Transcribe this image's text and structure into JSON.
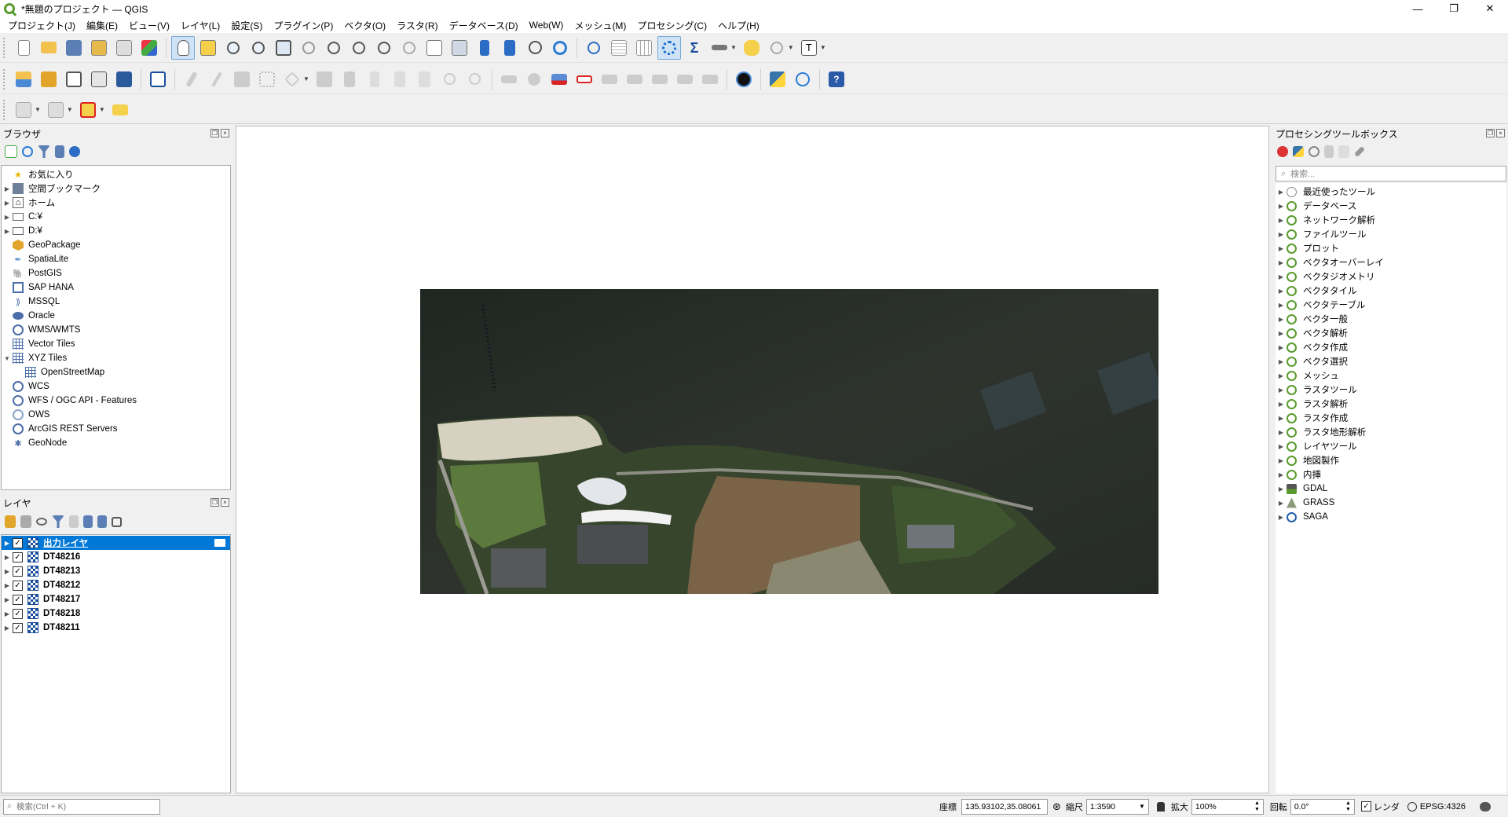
{
  "window": {
    "title": "*無題のプロジェクト — QGIS",
    "minimize": "—",
    "restore": "❐",
    "close": "✕"
  },
  "menu": [
    "プロジェクト(J)",
    "編集(E)",
    "ビュー(V)",
    "レイヤ(L)",
    "設定(S)",
    "プラグイン(P)",
    "ベクタ(O)",
    "ラスタ(R)",
    "データベース(D)",
    "Web(W)",
    "メッシュ(M)",
    "プロセシング(C)",
    "ヘルプ(H)"
  ],
  "browser": {
    "title": "ブラウザ",
    "items": [
      {
        "label": "お気に入り",
        "icon": "star-icon",
        "arrow": "",
        "indent": 0
      },
      {
        "label": "空間ブックマーク",
        "icon": "bookmark-icon",
        "arrow": "▶",
        "indent": 0
      },
      {
        "label": "ホーム",
        "icon": "home-folder-icon",
        "arrow": "▶",
        "indent": 0
      },
      {
        "label": "C:¥",
        "icon": "drive-icon",
        "arrow": "▶",
        "indent": 0
      },
      {
        "label": "D:¥",
        "icon": "drive-icon",
        "arrow": "▶",
        "indent": 0
      },
      {
        "label": "GeoPackage",
        "icon": "geopackage-icon",
        "arrow": "",
        "indent": 0
      },
      {
        "label": "SpatiaLite",
        "icon": "spatialite-icon",
        "arrow": "",
        "indent": 0
      },
      {
        "label": "PostGIS",
        "icon": "postgis-icon",
        "arrow": "",
        "indent": 0
      },
      {
        "label": "SAP HANA",
        "icon": "sap-hana-icon",
        "arrow": "",
        "indent": 0
      },
      {
        "label": "MSSQL",
        "icon": "mssql-icon",
        "arrow": "",
        "indent": 0
      },
      {
        "label": "Oracle",
        "icon": "oracle-icon",
        "arrow": "",
        "indent": 0
      },
      {
        "label": "WMS/WMTS",
        "icon": "wms-globe-icon",
        "arrow": "",
        "indent": 0
      },
      {
        "label": "Vector Tiles",
        "icon": "vector-tiles-icon",
        "arrow": "",
        "indent": 0
      },
      {
        "label": "XYZ Tiles",
        "icon": "xyz-tiles-icon",
        "arrow": "▼",
        "indent": 0
      },
      {
        "label": "OpenStreetMap",
        "icon": "tile-grid-icon",
        "arrow": "",
        "indent": 1
      },
      {
        "label": "WCS",
        "icon": "wcs-globe-icon",
        "arrow": "",
        "indent": 0
      },
      {
        "label": "WFS / OGC API - Features",
        "icon": "wfs-globe-icon",
        "arrow": "",
        "indent": 0
      },
      {
        "label": "OWS",
        "icon": "ows-globe-icon",
        "arrow": "",
        "indent": 0
      },
      {
        "label": "ArcGIS REST Servers",
        "icon": "arcgis-globe-icon",
        "arrow": "",
        "indent": 0
      },
      {
        "label": "GeoNode",
        "icon": "geonode-icon",
        "arrow": "",
        "indent": 0
      }
    ]
  },
  "layers": {
    "title": "レイヤ",
    "items": [
      {
        "label": "出力レイヤ",
        "selected": true,
        "checked": true
      },
      {
        "label": "DT48216",
        "selected": false,
        "checked": true
      },
      {
        "label": "DT48213",
        "selected": false,
        "checked": true
      },
      {
        "label": "DT48212",
        "selected": false,
        "checked": true
      },
      {
        "label": "DT48217",
        "selected": false,
        "checked": true
      },
      {
        "label": "DT48218",
        "selected": false,
        "checked": true
      },
      {
        "label": "DT48211",
        "selected": false,
        "checked": true
      }
    ]
  },
  "processing": {
    "title": "プロセシングツールボックス",
    "search_placeholder": "検索...",
    "items": [
      {
        "label": "最近使ったツール",
        "icon": "clock-icon"
      },
      {
        "label": "データベース",
        "icon": "qgis-icon"
      },
      {
        "label": "ネットワーク解析",
        "icon": "qgis-icon"
      },
      {
        "label": "ファイルツール",
        "icon": "qgis-icon"
      },
      {
        "label": "プロット",
        "icon": "qgis-icon"
      },
      {
        "label": "ベクタオーバーレイ",
        "icon": "qgis-icon"
      },
      {
        "label": "ベクタジオメトリ",
        "icon": "qgis-icon"
      },
      {
        "label": "ベクタタイル",
        "icon": "qgis-icon"
      },
      {
        "label": "ベクタテーブル",
        "icon": "qgis-icon"
      },
      {
        "label": "ベクタ一般",
        "icon": "qgis-icon"
      },
      {
        "label": "ベクタ解析",
        "icon": "qgis-icon"
      },
      {
        "label": "ベクタ作成",
        "icon": "qgis-icon"
      },
      {
        "label": "ベクタ選択",
        "icon": "qgis-icon"
      },
      {
        "label": "メッシュ",
        "icon": "qgis-icon"
      },
      {
        "label": "ラスタツール",
        "icon": "qgis-icon"
      },
      {
        "label": "ラスタ解析",
        "icon": "qgis-icon"
      },
      {
        "label": "ラスタ作成",
        "icon": "qgis-icon"
      },
      {
        "label": "ラスタ地形解析",
        "icon": "qgis-icon"
      },
      {
        "label": "レイヤツール",
        "icon": "qgis-icon"
      },
      {
        "label": "地図製作",
        "icon": "qgis-icon"
      },
      {
        "label": "内挿",
        "icon": "qgis-icon"
      },
      {
        "label": "GDAL",
        "icon": "gdal-icon"
      },
      {
        "label": "GRASS",
        "icon": "grass-icon"
      },
      {
        "label": "SAGA",
        "icon": "saga-icon"
      }
    ]
  },
  "status": {
    "search_placeholder": "検索(Ctrl + K)",
    "coord_label": "座標",
    "coord_value": "135.93102,35.08061",
    "scale_label": "縮尺",
    "scale_value": "1:3590",
    "magnifier_label": "拡大",
    "magnifier_value": "100%",
    "rotation_label": "回転",
    "rotation_value": "0.0°",
    "render_label": "レンダ",
    "crs": "EPSG:4326"
  }
}
